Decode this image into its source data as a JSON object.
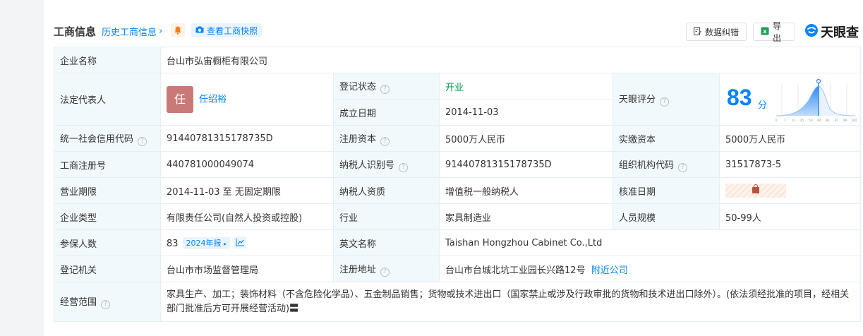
{
  "header": {
    "title": "工商信息",
    "history_link": "历史工商信息",
    "snapshot_label": "查看工商快照",
    "correction_label": "数据纠错",
    "export_label": "导出",
    "logo_text": "天眼查"
  },
  "labels": {
    "company_name": "企业名称",
    "legal_rep": "法定代表人",
    "reg_status": "登记状态",
    "founded": "成立日期",
    "score": "天眼评分",
    "credit_code": "统一社会信用代码",
    "reg_capital": "注册资本",
    "paid_capital": "实缴资本",
    "biz_reg_no": "工商注册号",
    "taxpayer_id": "纳税人识别号",
    "org_code": "组织机构代码",
    "biz_term": "营业期限",
    "taxpayer_qual": "纳税人资质",
    "approval_date": "核准日期",
    "company_type": "企业类型",
    "industry": "行业",
    "staff_size": "人员规模",
    "insured": "参保人数",
    "english_name": "英文名称",
    "reg_authority": "登记机关",
    "reg_address": "注册地址",
    "biz_scope": "经营范围"
  },
  "values": {
    "company_name": "台山市弘宙橱柜有限公司",
    "legal_rep_avatar": "任",
    "legal_rep": "任绍裕",
    "reg_status": "开业",
    "founded": "2014-11-03",
    "score": "83",
    "score_unit": "分",
    "credit_code": "91440781315178735D",
    "reg_capital": "5000万人民币",
    "paid_capital": "5000万人民币",
    "biz_reg_no": "440781000049074",
    "taxpayer_id": "91440781315178735D",
    "org_code": "31517873-5",
    "biz_term": "2014-11-03 至 无固定期限",
    "taxpayer_qual": "增值税一般纳税人",
    "company_type": "有限责任公司(自然人投资或控股)",
    "industry": "家具制造业",
    "staff_size": "50-99人",
    "insured": "83",
    "insured_report": "2024年报",
    "english_name": "Taishan Hongzhou Cabinet Co.,Ltd",
    "reg_authority": "台山市市场监督管理局",
    "reg_address": "台山市台城北坑工业园长兴路12号",
    "nearby_link": "附近公司",
    "biz_scope": "家具生产、加工；装饰材料（不含危险化学品）、五金制品销售；货物或技术进出口（国家禁止或涉及行政审批的货物和技术进出口除外）。(依法须经批准的项目，经相关部门批准后方可开展经营活动)"
  },
  "score_axis": [
    "0",
    "1",
    "13",
    "25",
    "50",
    "66",
    "91",
    "97",
    "99",
    "100"
  ],
  "colors": {
    "accent": "#0084ff",
    "status_green": "#009944",
    "label_bg": "#f2f9fc",
    "avatar": "#c97a78"
  }
}
